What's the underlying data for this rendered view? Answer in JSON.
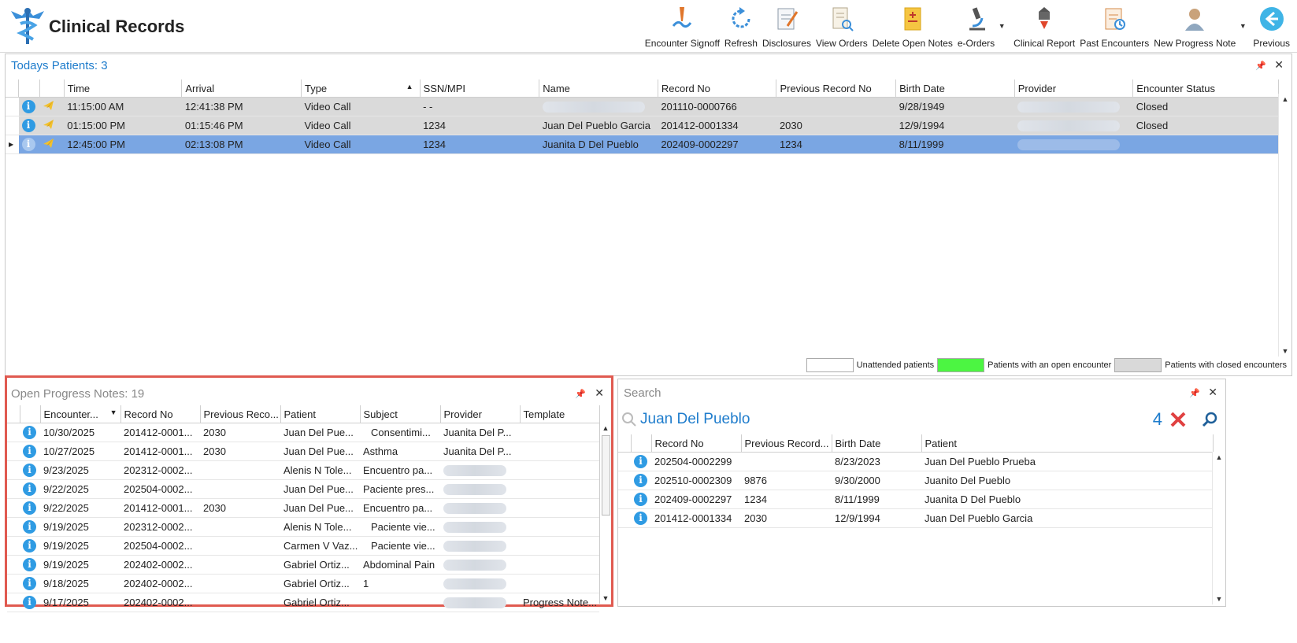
{
  "app": {
    "title": "Clinical Records"
  },
  "toolbar": {
    "buttons": [
      {
        "label": "Encounter Signoff",
        "icon": "signoff-pen-icon"
      },
      {
        "label": "Refresh",
        "icon": "refresh-icon"
      },
      {
        "label": "Disclosures",
        "icon": "disclosures-document-icon"
      },
      {
        "label": "View Orders",
        "icon": "view-orders-icon"
      },
      {
        "label": "Delete Open Notes",
        "icon": "delete-notes-icon"
      },
      {
        "label": "e-Orders",
        "icon": "microscope-icon"
      },
      {
        "label": "Clinical Report",
        "icon": "clinical-report-icon"
      },
      {
        "label": "Past Encounters",
        "icon": "past-encounters-icon"
      },
      {
        "label": "New Progress Note",
        "icon": "new-progress-note-icon"
      },
      {
        "label": "Previous",
        "icon": "previous-arrow-icon"
      }
    ]
  },
  "todays": {
    "title": "Todays Patients:",
    "count": "3",
    "columns": [
      "Time",
      "Arrival",
      "Type",
      "SSN/MPI",
      "Name",
      "Record No",
      "Previous Record No",
      "Birth Date",
      "Provider",
      "Encounter Status"
    ],
    "rows": [
      {
        "time": "11:15:00 AM",
        "arrival": "12:41:38 PM",
        "type": "Video Call",
        "ssn": "- -",
        "name": "",
        "record": "201110-0000766",
        "prev": "",
        "birth": "9/28/1949",
        "status": "Closed",
        "state": "closed"
      },
      {
        "time": "01:15:00 PM",
        "arrival": "01:15:46 PM",
        "type": "Video Call",
        "ssn": "1234",
        "name": "Juan Del Pueblo Garcia",
        "record": "201412-0001334",
        "prev": "2030",
        "birth": "12/9/1994",
        "status": "Closed",
        "state": "closed"
      },
      {
        "time": "12:45:00 PM",
        "arrival": "02:13:08 PM",
        "type": "Video Call",
        "ssn": "1234",
        "name": "Juanita D Del Pueblo",
        "record": "202409-0002297",
        "prev": "1234",
        "birth": "8/11/1999",
        "status": "",
        "state": "selected"
      }
    ],
    "legend": [
      {
        "label": "Unattended patients",
        "color": "#ffffff"
      },
      {
        "label": "Patients with an open encounter",
        "color": "#4cf542"
      },
      {
        "label": "Patients with closed encounters",
        "color": "#d9d9d9"
      }
    ]
  },
  "notes": {
    "title": "Open Progress Notes:",
    "count": "19",
    "columns": [
      "Encounter...",
      "Record No",
      "Previous Reco...",
      "Patient",
      "Subject",
      "Provider",
      "Template"
    ],
    "rows": [
      {
        "date": "10/30/2025",
        "record": "201412-0001...",
        "prev": "2030",
        "patient": "Juan Del Pue...",
        "subject": "Consentimi...",
        "provider": "Juanita Del P...",
        "template": ""
      },
      {
        "date": "10/27/2025",
        "record": "201412-0001...",
        "prev": "2030",
        "patient": "Juan Del Pue...",
        "subject": "Asthma",
        "provider": "Juanita Del P...",
        "template": ""
      },
      {
        "date": "9/23/2025",
        "record": "202312-0002...",
        "prev": "",
        "patient": "Alenis N Tole...",
        "subject": "Encuentro pa...",
        "provider": "",
        "template": ""
      },
      {
        "date": "9/22/2025",
        "record": "202504-0002...",
        "prev": "",
        "patient": "Juan Del Pue...",
        "subject": "Paciente pres...",
        "provider": "",
        "template": ""
      },
      {
        "date": "9/22/2025",
        "record": "201412-0001...",
        "prev": "2030",
        "patient": "Juan Del Pue...",
        "subject": "Encuentro pa...",
        "provider": "",
        "template": ""
      },
      {
        "date": "9/19/2025",
        "record": "202312-0002...",
        "prev": "",
        "patient": "Alenis N Tole...",
        "subject": "Paciente vie...",
        "provider": "",
        "template": ""
      },
      {
        "date": "9/19/2025",
        "record": "202504-0002...",
        "prev": "",
        "patient": "Carmen V Vaz...",
        "subject": "Paciente vie...",
        "provider": "",
        "template": ""
      },
      {
        "date": "9/19/2025",
        "record": "202402-0002...",
        "prev": "",
        "patient": "Gabriel Ortiz...",
        "subject": "Abdominal Pain",
        "provider": "",
        "template": ""
      },
      {
        "date": "9/18/2025",
        "record": "202402-0002...",
        "prev": "",
        "patient": "Gabriel Ortiz...",
        "subject": "1",
        "provider": "",
        "template": ""
      },
      {
        "date": "9/17/2025",
        "record": "202402-0002...",
        "prev": "",
        "patient": "Gabriel Ortiz...",
        "subject": "",
        "provider": "",
        "template": "Progress Note..."
      }
    ]
  },
  "search": {
    "title": "Search",
    "query": "Juan Del Pueblo",
    "count": "4",
    "columns": [
      "Record No",
      "Previous Record...",
      "Birth Date",
      "Patient"
    ],
    "rows": [
      {
        "record": "202504-0002299",
        "prev": "",
        "birth": "8/23/2023",
        "patient": "Juan Del Pueblo Prueba"
      },
      {
        "record": "202510-0002309",
        "prev": "9876",
        "birth": "9/30/2000",
        "patient": "Juanito Del Pueblo"
      },
      {
        "record": "202409-0002297",
        "prev": "1234",
        "birth": "8/11/1999",
        "patient": "Juanita D Del Pueblo"
      },
      {
        "record": "201412-0001334",
        "prev": "2030",
        "birth": "12/9/1994",
        "patient": "Juan Del Pueblo Garcia"
      }
    ]
  },
  "colors": {
    "accent": "#1e7ccc",
    "selected_row": "#7aa6e3",
    "closed_row": "#dadada",
    "highlight_border": "#e05a50",
    "info_icon": "#2f9be3"
  }
}
